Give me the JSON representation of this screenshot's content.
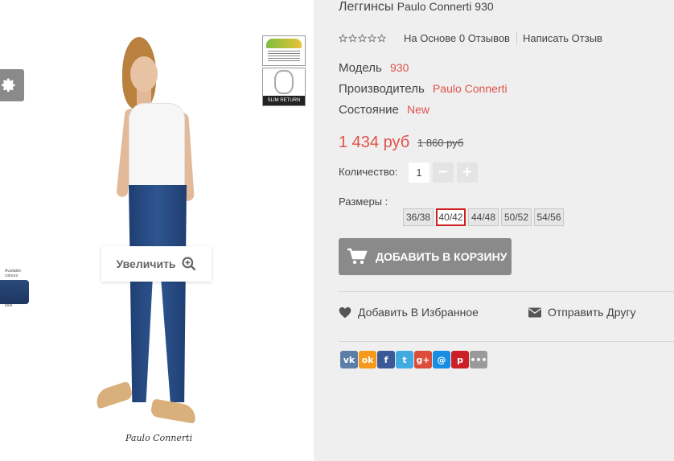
{
  "product": {
    "title_prefix": "Леггинсы",
    "title_brand": "Paulo Connerti 930",
    "reviews_link": "На Основе 0 Отзывов",
    "write_review": "Написать Отзыв",
    "rating_stars": 0,
    "specs": {
      "model_label": "Модель",
      "model_value": "930",
      "manufacturer_label": "Производитель",
      "manufacturer_value": "Paulo Connerti",
      "condition_label": "Состояние",
      "condition_value": "New"
    },
    "price": "1 434 руб",
    "old_price": "1 860 руб",
    "quantity_label": "Количество:",
    "quantity_value": "1",
    "sizes_label": "Размеры :",
    "sizes": [
      "36/38",
      "40/42",
      "44/48",
      "50/52",
      "54/56"
    ],
    "selected_size": "40/42",
    "add_to_cart": "ДОБАВИТЬ В КОРЗИНУ",
    "wishlist": "Добавить В Избранное",
    "send_friend": "Отправить Другу"
  },
  "image": {
    "zoom_label": "Увеличить",
    "brand_script": "Paulo Connerti",
    "badge_slim": "SLIM RETURN",
    "swatch_caption": "Available colours",
    "swatch_name": "blue"
  },
  "colors": {
    "accent_red": "#e0524a",
    "button_gray": "#8a8a8a",
    "selected_size_border": "#d01f1f"
  },
  "social": [
    {
      "name": "vk",
      "glyph": "vk",
      "color": "#5b7fa6"
    },
    {
      "name": "odnoklassniki",
      "glyph": "ok",
      "color": "#f59a1c"
    },
    {
      "name": "facebook",
      "glyph": "f",
      "color": "#3b5998"
    },
    {
      "name": "twitter",
      "glyph": "t",
      "color": "#41abe1"
    },
    {
      "name": "google-plus",
      "glyph": "g+",
      "color": "#dd4b39"
    },
    {
      "name": "mail-ru",
      "glyph": "@",
      "color": "#168de2"
    },
    {
      "name": "pinterest",
      "glyph": "p",
      "color": "#cb2027"
    },
    {
      "name": "more",
      "glyph": "•••",
      "color": "#9a9a9a"
    }
  ]
}
